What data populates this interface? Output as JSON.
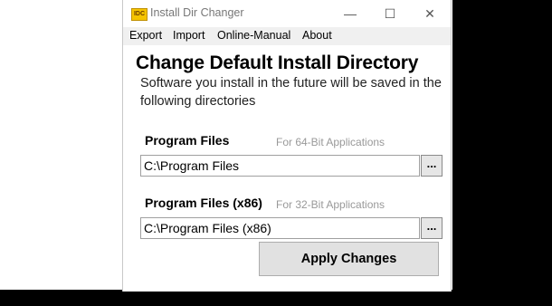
{
  "window": {
    "title": "Install Dir Changer",
    "icon_label": "IDC",
    "controls": {
      "minimize": "—",
      "maximize": "☐",
      "close": "✕"
    }
  },
  "menu": {
    "items": [
      "Export",
      "Import",
      "Online-Manual",
      "About"
    ]
  },
  "main": {
    "heading": "Change Default Install Directory",
    "description": "Software you install in the future will be saved in the following directories",
    "program_files": {
      "label": "Program Files",
      "hint": "For 64-Bit Applications",
      "value": "C:\\Program Files",
      "browse_label": "..."
    },
    "program_files_x86": {
      "label": "Program Files (x86)",
      "hint": "For 32-Bit Applications",
      "value": "C:\\Program Files (x86)",
      "browse_label": "..."
    },
    "apply_label": "Apply Changes"
  }
}
